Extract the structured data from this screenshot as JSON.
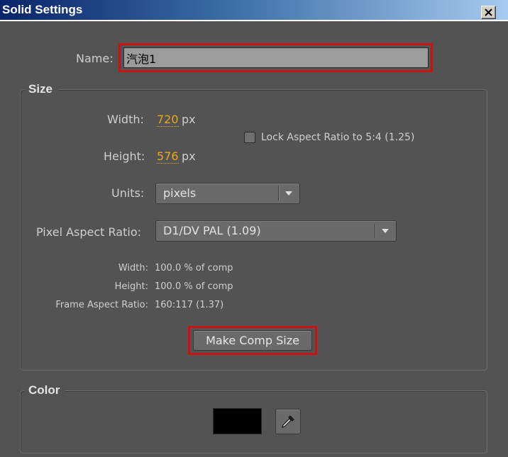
{
  "window": {
    "title": "Solid Settings",
    "close_label": "close"
  },
  "name": {
    "label": "Name:",
    "value": "汽泡1"
  },
  "size": {
    "group_title": "Size",
    "width_label": "Width:",
    "width_value": "720",
    "width_unit": "px",
    "height_label": "Height:",
    "height_value": "576",
    "height_unit": "px",
    "lock_aspect_label": "Lock Aspect Ratio to 5:4 (1.25)",
    "lock_aspect_checked": false,
    "units_label": "Units:",
    "units_value": "pixels",
    "par_label": "Pixel Aspect Ratio:",
    "par_value": "D1/DV PAL (1.09)",
    "info": {
      "width_label": "Width:",
      "width_value": "100.0 % of comp",
      "height_label": "Height:",
      "height_value": "100.0 % of comp",
      "frame_label": "Frame Aspect Ratio:",
      "frame_value": "160:117 (1.37)"
    },
    "make_comp_size_label": "Make Comp Size"
  },
  "color": {
    "group_title": "Color",
    "swatch_color": "#000000"
  },
  "icons": {
    "close": "close-icon",
    "dropdown": "chevron-down-icon",
    "eyedropper": "eyedropper-icon"
  },
  "colors": {
    "panel_bg": "#535353",
    "accent_value": "#e9a81b",
    "highlight_outline": "#cc1111"
  }
}
